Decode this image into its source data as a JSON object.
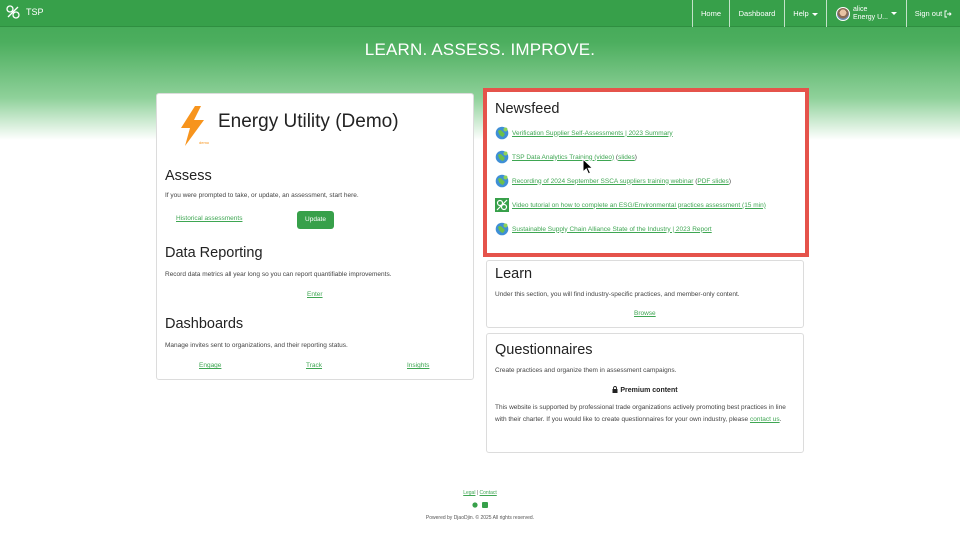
{
  "nav": {
    "brand": "TSP",
    "home": "Home",
    "dashboard": "Dashboard",
    "help": "Help",
    "user_name": "alice",
    "user_org": "Energy U...",
    "signout": "Sign out"
  },
  "hero": {
    "tagline": "LEARN. ASSESS. IMPROVE."
  },
  "org": {
    "name": "Energy Utility (Demo)",
    "logo_caption": "demo",
    "accent": "#f7941d"
  },
  "assess": {
    "title": "Assess",
    "desc": "If you were prompted to take, or update, an assessment, start here.",
    "historical": "Historical assessments",
    "update": "Update"
  },
  "data_reporting": {
    "title": "Data Reporting",
    "desc": "Record data metrics all year long so you can report quantifiable improvements.",
    "enter": "Enter"
  },
  "dashboards": {
    "title": "Dashboards",
    "desc": "Manage invites sent to organizations, and their reporting status.",
    "engage": "Engage",
    "track": "Track",
    "insights": "Insights"
  },
  "newsfeed": {
    "title": "Newsfeed",
    "items": [
      {
        "text": "Verification Supplier Self-Assessments | 2023 Summary",
        "icon": "globe-icon"
      },
      {
        "text": "TSP Data Analytics Training (video)",
        "extra_open": " (",
        "extra": "slides",
        "extra_close": ")",
        "icon": "globe-icon"
      },
      {
        "text": "Recording of 2024 September SSCA suppliers training webinar",
        "extra_open": " (",
        "extra": "PDF slides",
        "extra_close": ")",
        "icon": "globe-icon"
      },
      {
        "text": "Video tutorial on how to complete an ESG/Environmental practices assessment (15 min)",
        "icon": "tsp-logo-icon"
      },
      {
        "text": "Sustainable Supply Chain Alliance State of the Industry | 2023 Report",
        "icon": "globe-icon"
      }
    ]
  },
  "learn": {
    "title": "Learn",
    "desc": "Under this section, you will find industry-specific practices, and member-only content.",
    "browse": "Browse"
  },
  "questionnaires": {
    "title": "Questionnaires",
    "desc": "Create practices and organize them in assessment campaigns.",
    "premium": "Premium content",
    "body": "This website is supported by professional trade organizations actively promoting best practices in line with their charter. If you would like to create questionnaires for your own industry, please",
    "contact": "contact us",
    "period": "."
  },
  "footer": {
    "legal": "Legal",
    "sep": " | ",
    "contact": "Contact",
    "powered": "Powered by DjaoDjin. © 2025 All rights reserved."
  },
  "colors": {
    "primary": "#37a04a",
    "highlight": "#e5534b"
  }
}
